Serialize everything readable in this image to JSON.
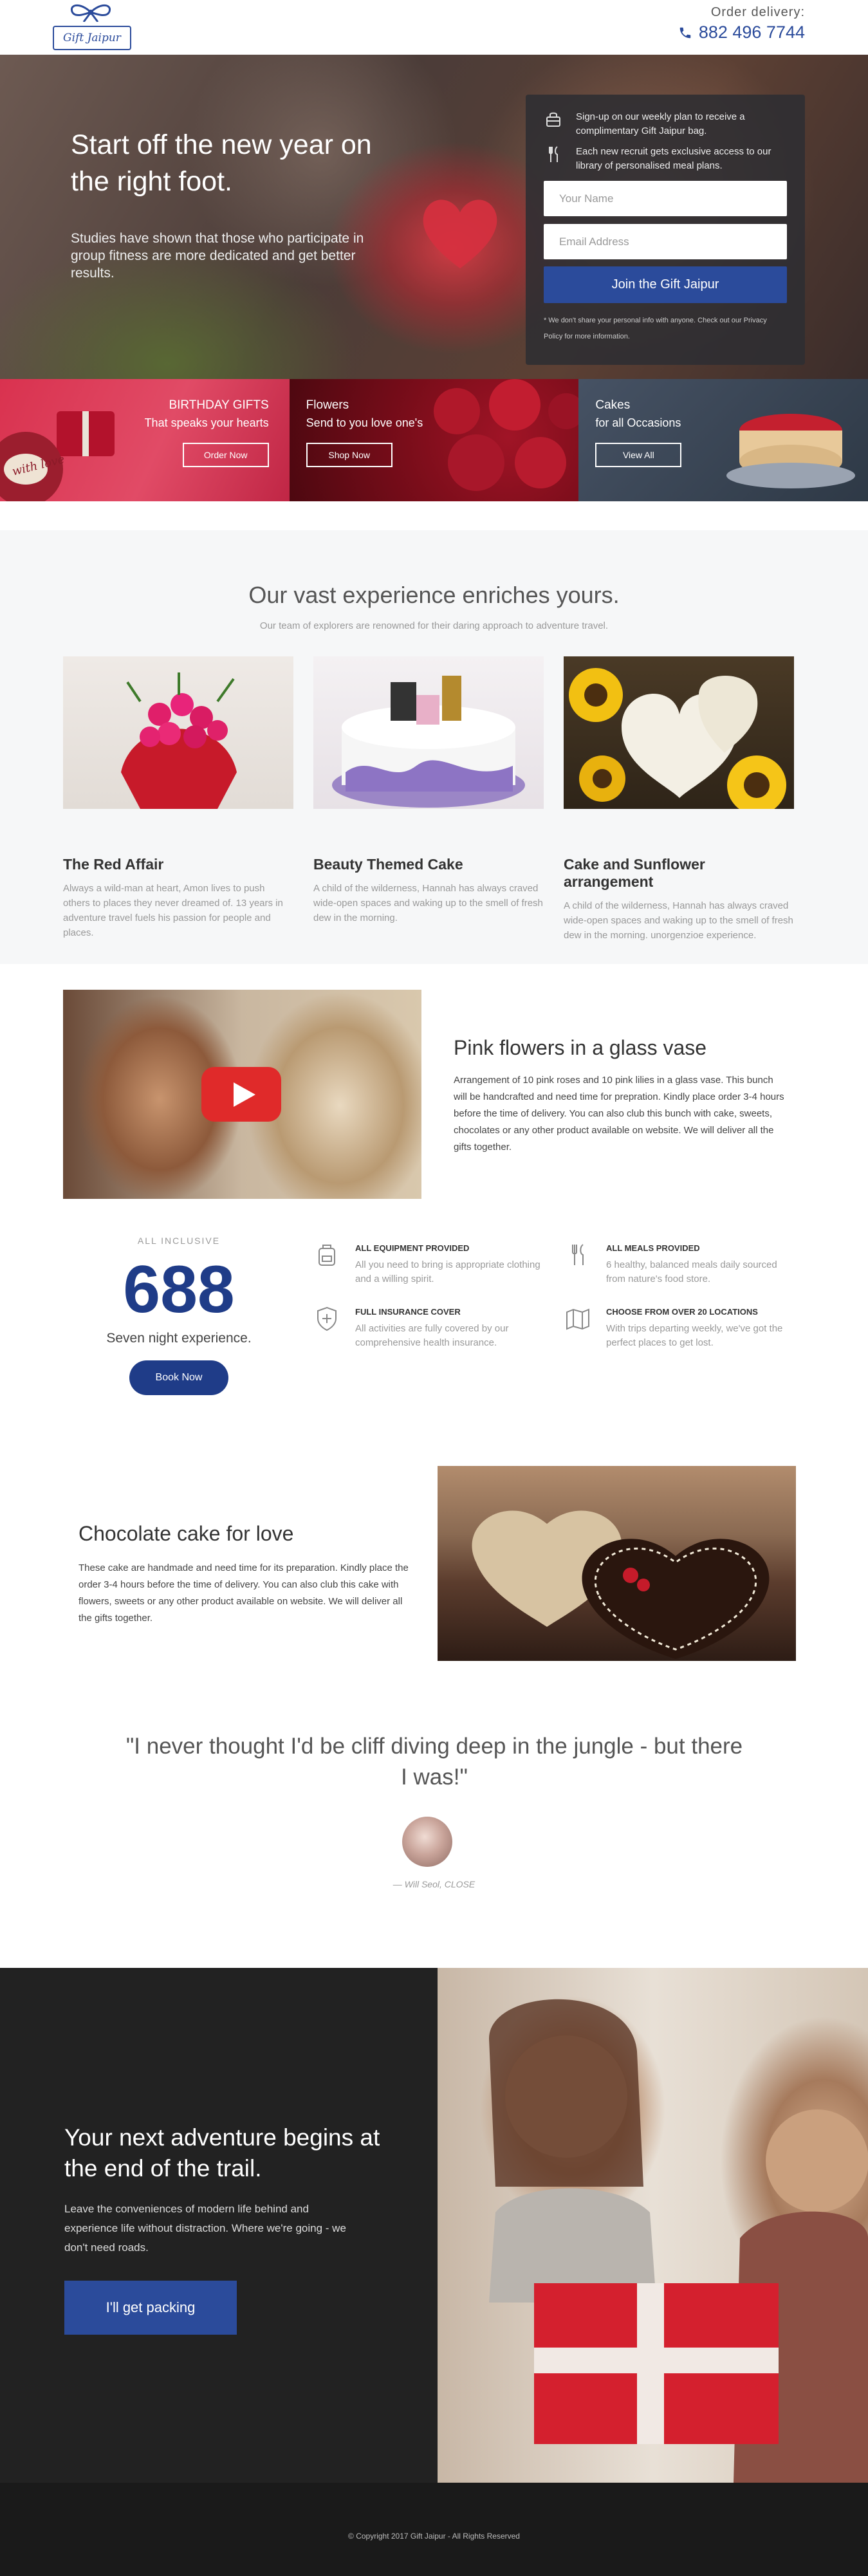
{
  "header": {
    "logo_text": "Gift Jaipur",
    "order_label": "Order delivery:",
    "phone": "882 496 7744"
  },
  "hero": {
    "title": "Start off the new year on the right foot.",
    "subtitle": "Studies have shown that those who participate in group fitness are more dedicated and get better results.",
    "signup": {
      "perk1": "Sign-up on our weekly plan to receive a complimentary Gift Jaipur bag.",
      "perk2": "Each new recruit gets exclusive access to our library of personalised meal plans.",
      "name_placeholder": "Your Name",
      "email_placeholder": "Email Address",
      "button": "Join the Gift Jaipur",
      "fine_print": "* We don't share your personal info with anyone. Check out our Privacy Policy for more information."
    }
  },
  "categories": [
    {
      "title": "BIRTHDAY GIFTS",
      "subtitle": "That speaks your hearts",
      "button": "Order Now",
      "mug_text": "with love"
    },
    {
      "title": "Flowers",
      "subtitle": "Send to you love one's",
      "button": "Shop Now"
    },
    {
      "title": "Cakes",
      "subtitle": "for all Occasions",
      "button": "View All"
    }
  ],
  "experience": {
    "title": "Our vast experience enriches yours.",
    "subtitle": "Our team of explorers are renowned for their daring approach to adventure travel.",
    "cards": [
      {
        "title": "The Red Affair",
        "text": "Always a wild-man at heart, Amon lives to push others to places they never dreamed of. 13 years in adventure travel fuels his passion for people and places."
      },
      {
        "title": "Beauty Themed Cake",
        "text": "A child of the wilderness, Hannah has always craved wide-open spaces and waking up to the smell of fresh dew in the morning."
      },
      {
        "title": "Cake and Sunflower arrangement",
        "text": "A child of the wilderness, Hannah has always craved wide-open spaces and waking up to the smell of fresh dew in the morning. unorgenzioe experience."
      }
    ]
  },
  "pink": {
    "title": "Pink flowers in a glass vase",
    "text": "Arrangement of 10 pink roses and 10 pink lilies in a glass vase. This bunch will be handcrafted and need time for prepration. Kindly place order 3-4 hours before the time of delivery. You can also club this bunch with cake, sweets, chocolates or any other product available on website. We will deliver all the gifts together."
  },
  "stats": {
    "label": "ALL INCLUSIVE",
    "number": "688",
    "caption": "Seven night experience.",
    "button": "Book Now",
    "features": [
      {
        "title": "ALL EQUIPMENT PROVIDED",
        "text": "All you need to bring is appropriate clothing and a willing spirit.",
        "icon": "backpack-icon"
      },
      {
        "title": "ALL MEALS PROVIDED",
        "text": "6 healthy, balanced meals daily sourced from nature's food store.",
        "icon": "fork-knife-icon"
      },
      {
        "title": "FULL INSURANCE COVER",
        "text": "All activities are fully covered by our comprehensive health insurance.",
        "icon": "shield-plus-icon"
      },
      {
        "title": "CHOOSE FROM OVER 20 LOCATIONS",
        "text": "With trips departing weekly, we've got the perfect places to get lost.",
        "icon": "map-icon"
      }
    ]
  },
  "choco": {
    "title": "Chocolate cake for love",
    "text": "These cake are handmade and need time for its preparation. Kindly place the order 3-4 hours before the time of delivery. You can also club this cake with flowers, sweets or any other product available on website. We will deliver all the gifts together."
  },
  "quote": {
    "text": "\"I never thought I'd be cliff diving deep in the jungle - but there I was!\"",
    "author": "— Will Seol, CLOSE"
  },
  "adventure": {
    "title": "Your next adventure begins at the end of the trail.",
    "text": "Leave the conveniences of modern life behind and experience life without distraction. Where we're going - we don't need roads.",
    "button": "I'll get packing"
  },
  "footer": {
    "copyright": "© Copyright 2017 Gift Jaipur - All Rights Reserved"
  },
  "colors": {
    "brand_blue": "#2b4b9b",
    "dark_navy": "#1f3c88",
    "footer_dark": "#1a1a1a"
  }
}
